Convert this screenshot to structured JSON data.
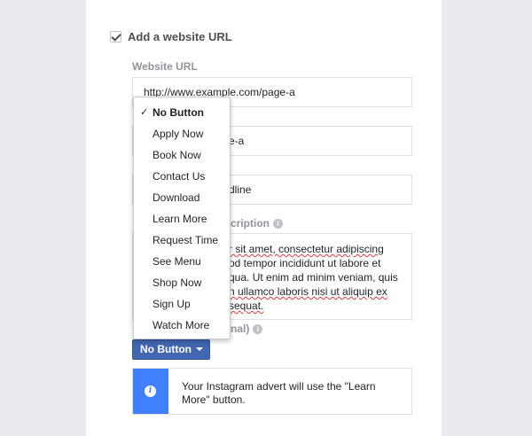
{
  "url_section": {
    "checkbox_label": "Add a website URL",
    "website_url_label": "Website URL",
    "website_url_value": "http://www.example.com/page-a",
    "field2_visible_value": "e-a",
    "field3_visible_value": "dline",
    "description_label_visible": "cription",
    "description_lines": [
      "r sit amet, consectetur adipiscing",
      "od tempor incididunt ut labore et",
      "qua. Ut enim ad minim veniam, quis",
      "n ullamco laboris nisi ut aliquip ex",
      "sequat."
    ],
    "cta_label_visible": "nal)"
  },
  "cta_button": {
    "label": "No Button"
  },
  "dropdown": {
    "check_glyph": "✓",
    "items": [
      {
        "label": "No Button",
        "selected": true
      },
      {
        "label": "Apply Now"
      },
      {
        "label": "Book Now"
      },
      {
        "label": "Contact Us"
      },
      {
        "label": "Download"
      },
      {
        "label": "Learn More"
      },
      {
        "label": "Request Time"
      },
      {
        "label": "See Menu"
      },
      {
        "label": "Shop Now"
      },
      {
        "label": "Sign Up"
      },
      {
        "label": "Watch More"
      }
    ]
  },
  "notice": {
    "icon": "info-icon",
    "text": "Your Instagram advert will use the \"Learn More\" button."
  },
  "colors": {
    "page_background": "#e9ebee",
    "primary_button": "#4267b2",
    "notice_accent": "#4080ff"
  }
}
